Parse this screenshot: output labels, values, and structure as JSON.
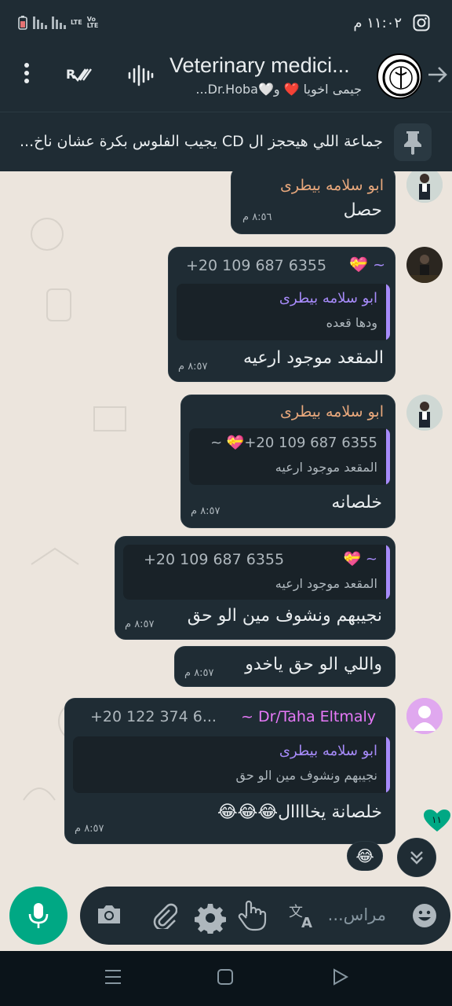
{
  "status": {
    "time": "١١:٠٢ م",
    "network": "LTE",
    "volte": "Vo LTE"
  },
  "header": {
    "title": "Veterinary medici...",
    "subtitle": "جيمى اخويا ❤️ و🤍Dr.Hoba..."
  },
  "pinned": {
    "text": "جماعة اللي هيحجز ال CD يجيب الفلوس بكرة عشان ناخ..."
  },
  "messages": [
    {
      "sender": "ابو سلامه بيطرى",
      "text": "حصل",
      "time": "٨:٥٦ م"
    },
    {
      "phone": "+20 109 687 6355",
      "sender_mark": "~ 💝",
      "quote_name": "ابو سلامه بيطرى",
      "quote_text": "ودها قعده",
      "text": "المقعد موجود ارعيه",
      "time": "٨:٥٧ م"
    },
    {
      "sender": "ابو سلامه بيطرى",
      "quote_name": "~ 💝+20 109 687 6355",
      "quote_text": "المقعد موجود ارعيه",
      "text": "خلصانه",
      "time": "٨:٥٧ م"
    },
    {
      "quote_name": "~ 💝",
      "quote_phone": "+20 109 687 6355",
      "quote_text": "المقعد موجود ارعيه",
      "text": "نجيبهم ونشوف مين الو حق",
      "time": "٨:٥٧ م"
    },
    {
      "text": "واللي الو حق ياخدو",
      "time": "٨:٥٧ م"
    },
    {
      "sender": "~ Dr/Taha Eltmaly",
      "phone": "+20 122 374 6...",
      "quote_name": "ابو سلامه بيطرى",
      "quote_text": "نجيبهم ونشوف مين الو حق",
      "text": "خلصانة يخاااال😂😂😂",
      "time": "٨:٥٧ م"
    }
  ],
  "reaction": "😂",
  "unread_count": "١١",
  "input": {
    "placeholder": "مراس..."
  },
  "colors": {
    "accent": "#00a884",
    "bubble": "#1f2c34",
    "sender_orange": "#e8a87c",
    "sender_purple": "#a78bfa",
    "sender_pink": "#e879f9"
  }
}
